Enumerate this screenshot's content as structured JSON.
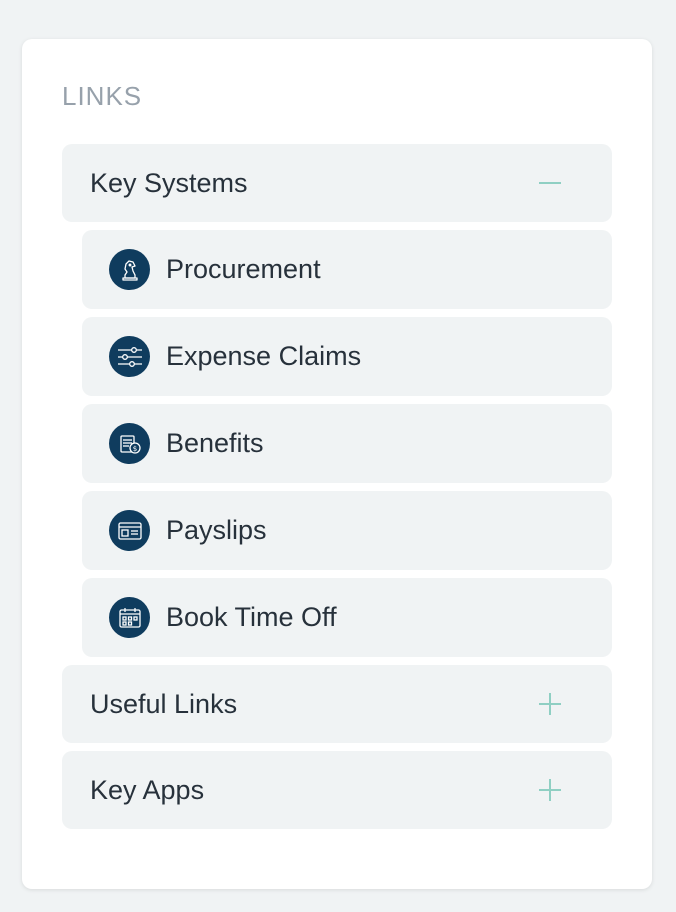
{
  "section_title": "LINKS",
  "accordion": [
    {
      "label": "Key Systems",
      "expanded": true,
      "toggle_icon": "minus-icon",
      "items": [
        {
          "label": "Procurement",
          "icon": "chess-knight-icon"
        },
        {
          "label": "Expense Claims",
          "icon": "sliders-icon"
        },
        {
          "label": "Benefits",
          "icon": "cash-register-icon"
        },
        {
          "label": "Payslips",
          "icon": "id-card-icon"
        },
        {
          "label": "Book Time Off",
          "icon": "calendar-icon"
        }
      ]
    },
    {
      "label": "Useful Links",
      "expanded": false,
      "toggle_icon": "plus-icon"
    },
    {
      "label": "Key Apps",
      "expanded": false,
      "toggle_icon": "plus-icon"
    }
  ],
  "colors": {
    "page_bg": "#f0f3f4",
    "card_bg": "#ffffff",
    "item_bg": "#f0f3f4",
    "icon_bg": "#0f3c5e",
    "toggle": "#8fcfc3",
    "title": "#97a1ab",
    "text": "#27313b"
  }
}
